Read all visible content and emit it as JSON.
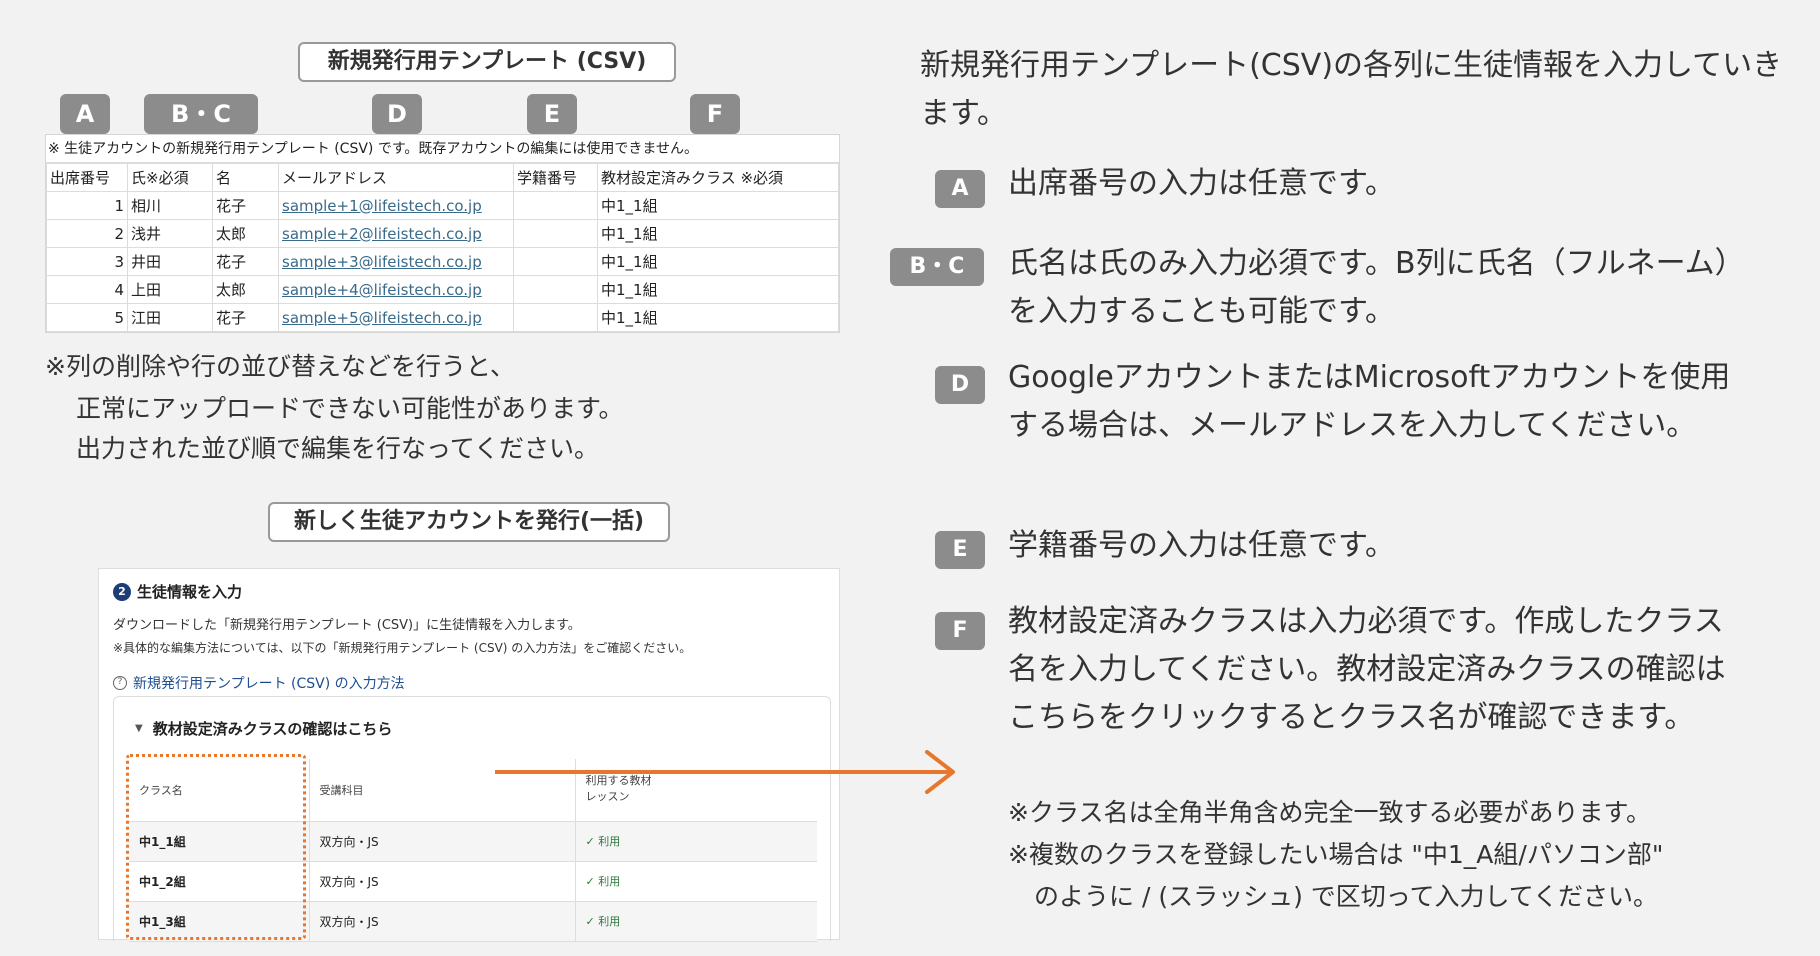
{
  "csv_title": "新規発行用テンプレート (CSV)",
  "badges": {
    "a": "A",
    "bc": "B・C",
    "d": "D",
    "e": "E",
    "f": "F"
  },
  "sheet": {
    "note": "※ 生徒アカウントの新規発行用テンプレート (CSV) です。既存アカウントの編集には使用できません。",
    "headers": [
      "出席番号",
      "氏※必須",
      "名",
      "メールアドレス",
      "学籍番号",
      "教材設定済みクラス ※必須"
    ],
    "rows": [
      [
        "1",
        "相川",
        "花子",
        "sample+1@lifeistech.co.jp",
        "",
        "中1_1組"
      ],
      [
        "2",
        "浅井",
        "太郎",
        "sample+2@lifeistech.co.jp",
        "",
        "中1_1組"
      ],
      [
        "3",
        "井田",
        "花子",
        "sample+3@lifeistech.co.jp",
        "",
        "中1_1組"
      ],
      [
        "4",
        "上田",
        "太郎",
        "sample+4@lifeistech.co.jp",
        "",
        "中1_1組"
      ],
      [
        "5",
        "江田",
        "花子",
        "sample+5@lifeistech.co.jp",
        "",
        "中1_1組"
      ]
    ]
  },
  "warning": {
    "line1": "※列の削除や行の並び替えなどを行うと、",
    "line2": "正常にアップロードできない可能性があります。",
    "line3": "出力された並び順で編集を行なってください。"
  },
  "bulk_title": "新しく生徒アカウントを発行(一括)",
  "panel": {
    "step_number": "2",
    "step_title": "生徒情報を入力",
    "desc1": "ダウンロードした「新規発行用テンプレート (CSV)」に生徒情報を入力します。",
    "desc2": "※具体的な編集方法については、以下の「新規発行用テンプレート (CSV) の入力方法」をご確認ください。",
    "howto_link": "新規発行用テンプレート (CSV) の入力方法",
    "accordion": "教材設定済みクラスの確認はこちら",
    "col_class": "クラス名",
    "col_subject": "受講科目",
    "col_material_1": "利用する教材",
    "col_material_2": "レッスン",
    "rows": [
      {
        "cls": "中1_1組",
        "subject": "双方向・JS",
        "status": "利用"
      },
      {
        "cls": "中1_2組",
        "subject": "双方向・JS",
        "status": "利用"
      },
      {
        "cls": "中1_3組",
        "subject": "双方向・JS",
        "status": "利用"
      }
    ]
  },
  "right": {
    "intro": "新規発行用テンプレート(CSV)の各列に生徒情報を入力していきます。",
    "a": "出席番号の入力は任意です。",
    "bc": "氏名は氏のみ入力必須です。B列に氏名（フルネーム）を入力することも可能です。",
    "d": "GoogleアカウントまたはMicrosoftアカウントを使用する場合は、メールアドレスを入力してください。",
    "e": "学籍番号の入力は任意です。",
    "f": "教材設定済みクラスは入力必須です。作成したクラス名を入力してください。教材設定済みクラスの確認はこちらをクリックするとクラス名が確認できます。",
    "note1": "※クラス名は全角半角含め完全一致する必要があります。",
    "note2": "※複数のクラスを登録したい場合は \"中1_A組/パソコン部\"",
    "note3": "のように / (スラッシュ) で区切って入力してください。"
  },
  "colors": {
    "accent_orange": "#e8772e",
    "badge_gray": "#8c8c8c",
    "link_blue": "#1d4f91"
  }
}
